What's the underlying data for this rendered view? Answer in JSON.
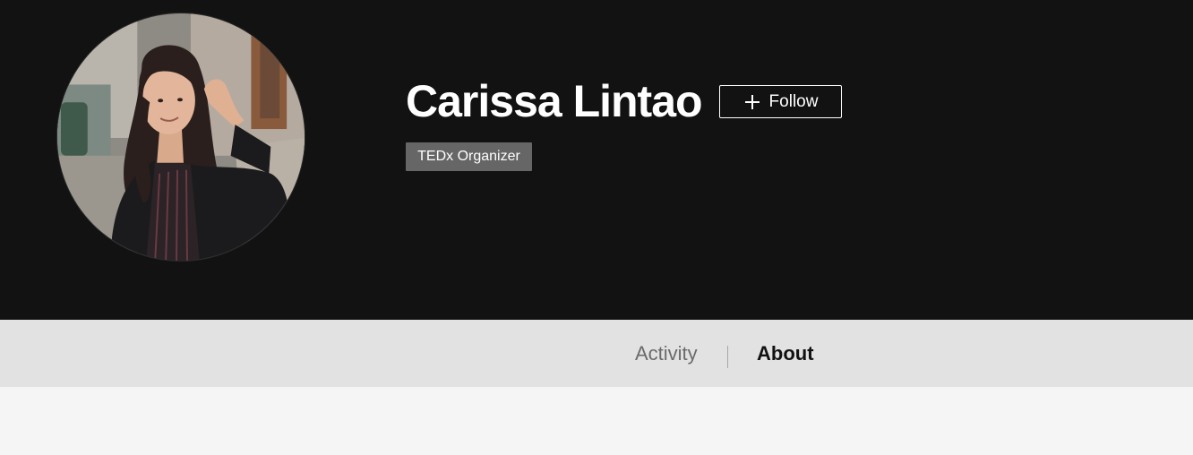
{
  "profile": {
    "name": "Carissa Lintao",
    "follow_label": "Follow",
    "badge": "TEDx Organizer",
    "avatar_description": "profile photo"
  },
  "tabs": [
    {
      "label": "Activity",
      "active": false
    },
    {
      "label": "About",
      "active": true
    }
  ],
  "icons": {
    "follow": "plus-icon"
  },
  "colors": {
    "hero_background": "#121212",
    "tabbar_background": "#e2e2e2",
    "badge_background": "#666666",
    "page_background": "#f5f5f5"
  }
}
